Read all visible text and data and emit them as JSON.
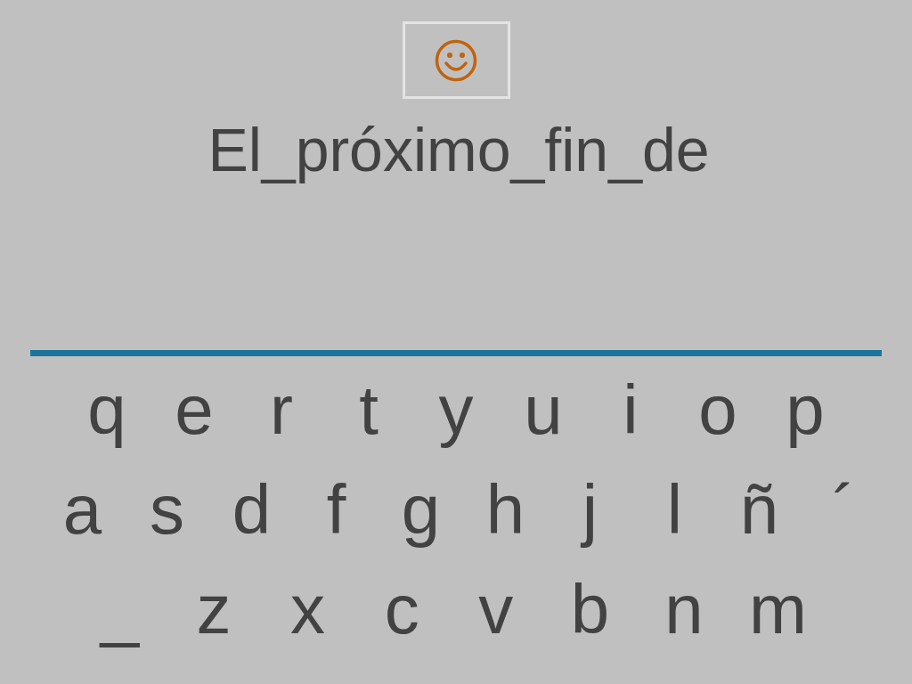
{
  "sentence": "El_próximo_fin_de",
  "keyboard": {
    "rows": [
      [
        "q",
        "e",
        "r",
        "t",
        "y",
        "u",
        "i",
        "o",
        "p"
      ],
      [
        "a",
        "s",
        "d",
        "f",
        "g",
        "h",
        "j",
        "l",
        "ñ",
        "´"
      ],
      [
        "_",
        "z",
        "x",
        "c",
        "v",
        "b",
        "n",
        "m"
      ]
    ]
  }
}
